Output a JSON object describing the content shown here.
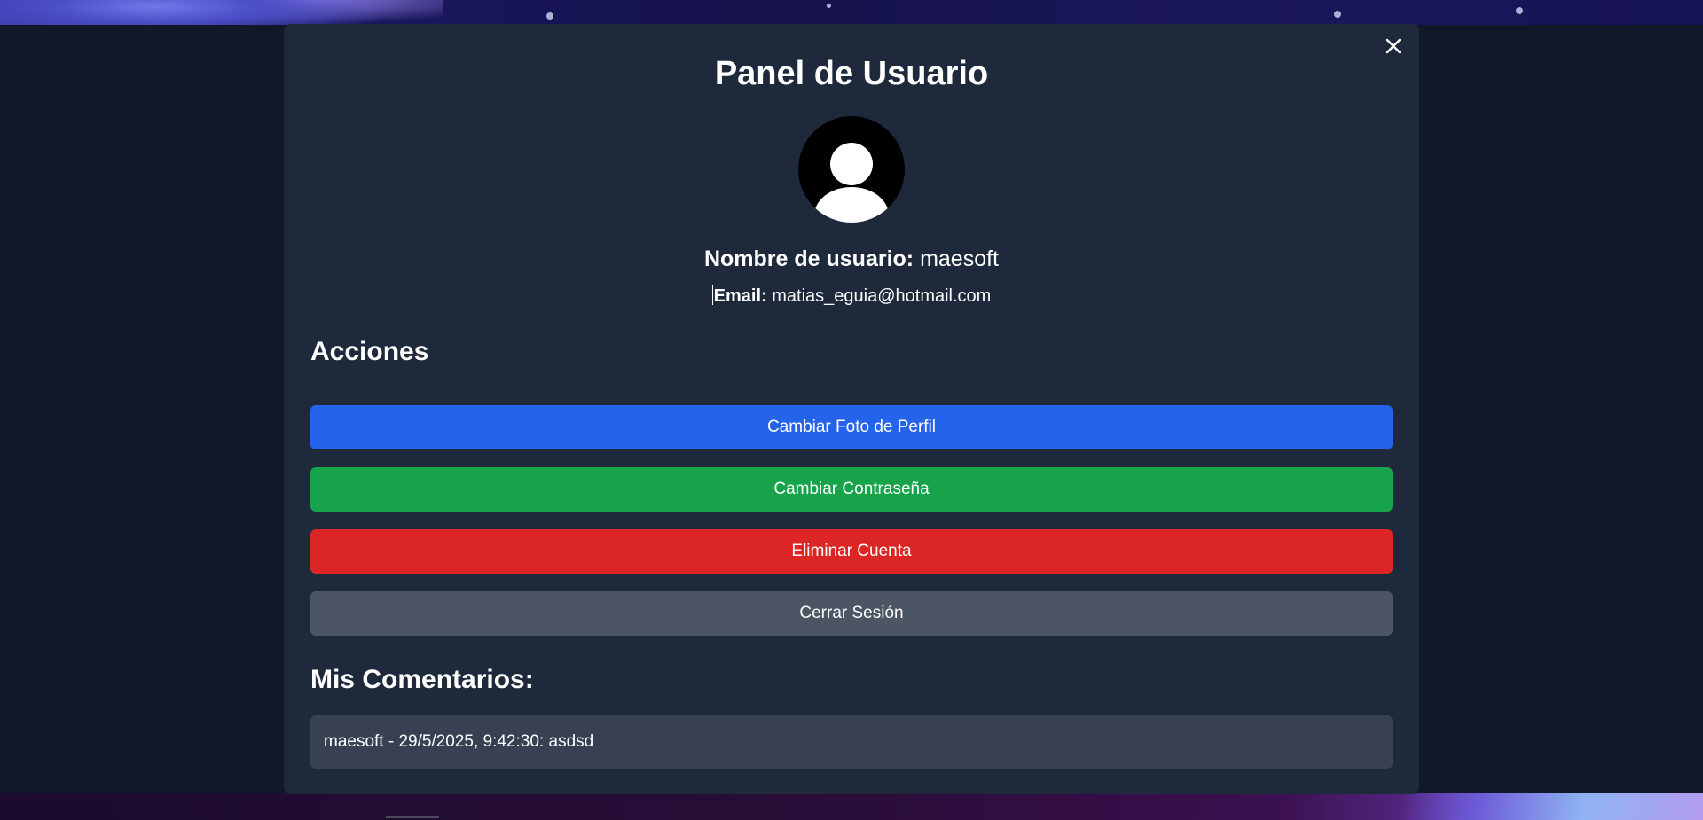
{
  "modal": {
    "title": "Panel de Usuario",
    "close_icon": "close-icon"
  },
  "profile": {
    "avatar_icon": "user-avatar-icon",
    "username_label": "Nombre de usuario:",
    "username_value": "maesoft",
    "email_label": "Email:",
    "email_value": "matias_eguia@hotmail.com"
  },
  "actions": {
    "heading": "Acciones",
    "change_photo_label": "Cambiar Foto de Perfil",
    "change_password_label": "Cambiar Contraseña",
    "delete_account_label": "Eliminar Cuenta",
    "logout_label": "Cerrar Sesión"
  },
  "comments": {
    "heading": "Mis Comentarios:",
    "items": [
      {
        "text": "maesoft - 29/5/2025, 9:42:30: asdsd"
      }
    ]
  },
  "colors": {
    "modal_bg": "#1e293b",
    "page_bg": "#111827",
    "blue": "#2563eb",
    "green": "#16a34a",
    "red": "#dc2626",
    "gray": "#4b5563",
    "comment_bg": "#374151"
  }
}
